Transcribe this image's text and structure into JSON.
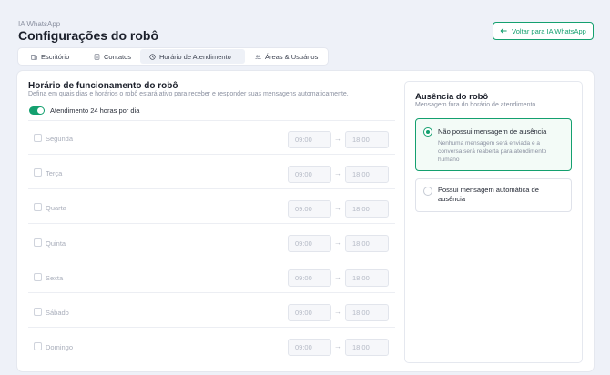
{
  "header": {
    "breadcrumb": "IA WhatsApp",
    "title": "Configurações do robô",
    "back_button": "Voltar para IA WhatsApp"
  },
  "tabs": [
    {
      "label": "Escritório",
      "icon": "building-icon"
    },
    {
      "label": "Contatos",
      "icon": "contacts-icon"
    },
    {
      "label": "Horário de Atendimento",
      "icon": "clock-icon",
      "active": true
    },
    {
      "label": "Áreas & Usuários",
      "icon": "users-icon"
    }
  ],
  "schedule": {
    "title": "Horário de funcionamento do robô",
    "description": "Defina em quais dias e horários o robô estará ativo para receber e responder suas mensagens automaticamente.",
    "toggle_label": "Atendimento 24 horas por dia",
    "toggle_on": true,
    "days": [
      {
        "name": "Segunda",
        "start": "09:00",
        "end": "18:00"
      },
      {
        "name": "Terça",
        "start": "09:00",
        "end": "18:00"
      },
      {
        "name": "Quarta",
        "start": "09:00",
        "end": "18:00"
      },
      {
        "name": "Quinta",
        "start": "09:00",
        "end": "18:00"
      },
      {
        "name": "Sexta",
        "start": "09:00",
        "end": "18:00"
      },
      {
        "name": "Sábado",
        "start": "09:00",
        "end": "18:00"
      },
      {
        "name": "Domingo",
        "start": "09:00",
        "end": "18:00"
      }
    ],
    "arrow": "→"
  },
  "absence": {
    "title": "Ausência do robô",
    "subtitle": "Mensagem fora do horário de atendimento",
    "options": [
      {
        "title": "Não possui mensagem de ausência",
        "description_lines": [
          "Nenhuma mensagem será enviada e a",
          "conversa será reaberta para atendimento",
          "humano"
        ],
        "selected": true
      },
      {
        "title_lines": [
          "Possui mensagem automática de",
          "ausência"
        ],
        "selected": false
      }
    ]
  },
  "colors": {
    "accent": "#14a06f",
    "background": "#eef1f8"
  }
}
